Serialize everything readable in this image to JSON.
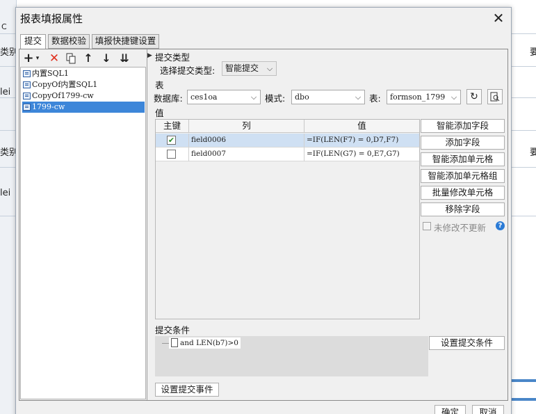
{
  "background": {
    "header_cell": "C",
    "left_texts": [
      "类别",
      "lei",
      "类别",
      "lei"
    ],
    "right_texts": [
      "要",
      "要"
    ]
  },
  "dialog": {
    "title": "报表填报属性",
    "close_icon": "close-icon",
    "tabs": [
      {
        "label": "提交",
        "active": true
      },
      {
        "label": "数据校验",
        "active": false
      },
      {
        "label": "填报快捷键设置",
        "active": false
      }
    ],
    "toolbar": {
      "add": "+",
      "add_dropdown": "▾",
      "delete": "✕",
      "copy": "copy-icon",
      "up": "↑",
      "down": "↓",
      "bottom": "⇊"
    },
    "tree_items": [
      {
        "label": "内置SQL1",
        "selected": false
      },
      {
        "label": "CopyOf内置SQL1",
        "selected": false
      },
      {
        "label": "CopyOf1799-cw",
        "selected": false
      },
      {
        "label": "1799-cw",
        "selected": true
      }
    ],
    "submit_type_section": "提交类型",
    "submit_type_label": "选择提交类型:",
    "submit_type_value": "智能提交",
    "table_section": "表",
    "database_label": "数据库:",
    "database_value": "ces1oa",
    "schema_label": "模式:",
    "schema_value": "dbo",
    "table_label": "表:",
    "table_value": "formson_1799",
    "refresh_icon": "refresh-icon",
    "preview_icon": "preview-icon",
    "value_section": "值",
    "grid": {
      "headers": [
        "主键",
        "列",
        "值"
      ],
      "rows": [
        {
          "key": true,
          "column": "field0006",
          "value": "=IF(LEN(F7) = 0,D7,F7)",
          "selected": true
        },
        {
          "key": false,
          "column": "field0007",
          "value": "=IF(LEN(G7) = 0,E7,G7)",
          "selected": false
        }
      ]
    },
    "side_buttons": [
      "智能添加字段",
      "添加字段",
      "智能添加单元格",
      "智能添加单元格组",
      "批量修改单元格",
      "移除字段"
    ],
    "no_update_label": "未修改不更新",
    "help_icon": "?",
    "condition_section": "提交条件",
    "condition_item": "and LEN(b7)>0",
    "set_condition_button": "设置提交条件",
    "set_event_button": "设置提交事件",
    "ok_button": "确定",
    "cancel_button": "取消"
  }
}
